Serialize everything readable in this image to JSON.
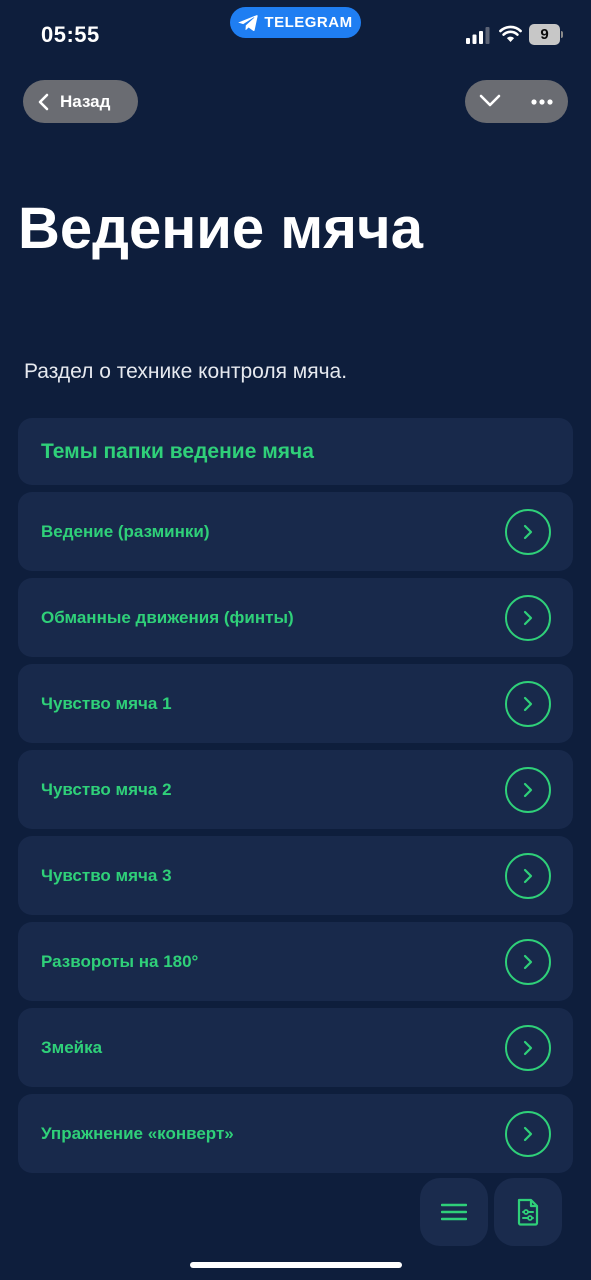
{
  "status_bar": {
    "time": "05:55",
    "app_pill": "TELEGRAM",
    "battery": "9"
  },
  "nav": {
    "back_label": "Назад",
    "icons": [
      "chevron-left-icon",
      "chevron-down-icon",
      "more-dots-icon"
    ]
  },
  "page": {
    "title": "Ведение мяча",
    "subtitle": "Раздел о технике контроля мяча."
  },
  "section": {
    "title": "Темы папки ведение мяча"
  },
  "topics": [
    {
      "label": "Ведение (разминки)"
    },
    {
      "label": "Обманные движения (финты)"
    },
    {
      "label": "Чувство мяча 1"
    },
    {
      "label": "Чувство мяча 2"
    },
    {
      "label": "Чувство мяча 3"
    },
    {
      "label": "Развороты на 180°"
    },
    {
      "label": "Змейка"
    },
    {
      "label": "Упражнение «конверт»"
    }
  ],
  "bottom_actions": {
    "icons": [
      "menu-icon",
      "document-settings-icon"
    ]
  },
  "colors": {
    "background": "#0e1e3c",
    "card": "#18294b",
    "accent_green": "#2fd079",
    "telegram_blue": "#1f7ef2",
    "nav_pill": "#6a6c72"
  }
}
